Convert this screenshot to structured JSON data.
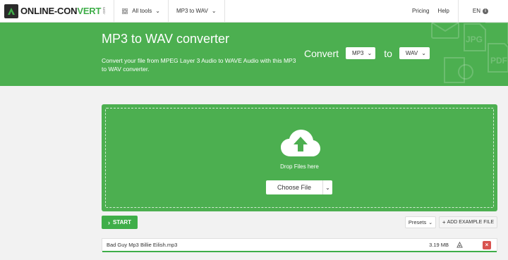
{
  "nav": {
    "logo_text_dark": "ONLINE-CON",
    "logo_text_accent": "VERT",
    "logo_com": ".com",
    "all_tools": "All tools",
    "converter_menu": "MP3 to WAV",
    "pricing": "Pricing",
    "help": "Help",
    "lang": "EN"
  },
  "hero": {
    "title": "MP3 to WAV converter",
    "description": "Convert your file from MPEG Layer 3 Audio to WAVE Audio with this MP3 to WAV converter.",
    "convert_label": "Convert",
    "from_value": "MP3",
    "to_label": "to",
    "to_value": "WAV"
  },
  "upload": {
    "drop_text": "Drop Files here",
    "choose_file": "Choose File"
  },
  "actions": {
    "start": "START",
    "presets": "Presets",
    "add_example": "ADD EXAMPLE FILE"
  },
  "file": {
    "name": "Bad Guy Mp3 Billie Eilish.mp3",
    "size": "3.19 MB"
  },
  "colors": {
    "brand_green": "#4caf50",
    "button_green": "#3fae49",
    "delete_red": "#d9534f"
  }
}
